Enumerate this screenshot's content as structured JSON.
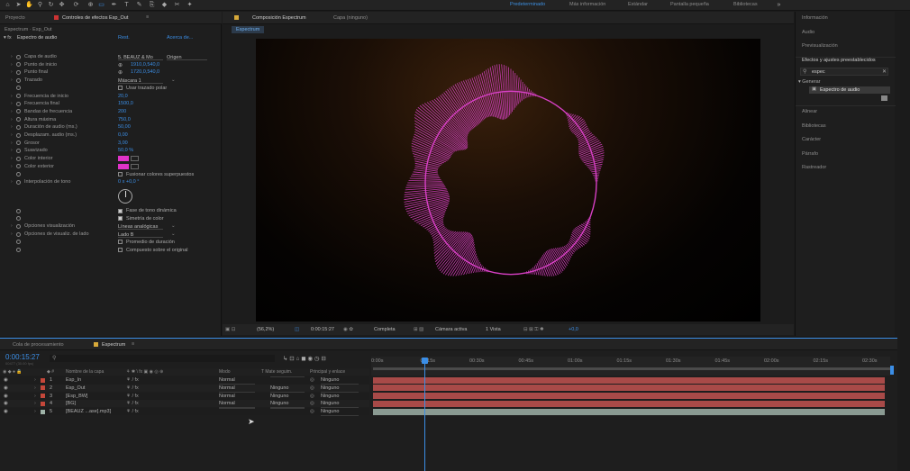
{
  "workspaces": [
    "Predeterminado",
    "Más información",
    "Estándar",
    "Pantalla pequeña",
    "Bibliotecas"
  ],
  "left_tabs": {
    "project": "Proyecto",
    "effects": "Controles de efectos Esp_Out",
    "subtitle": "Espectrum · Esp_Out"
  },
  "effect": {
    "name": "Espectro de audio",
    "reset": "Rest.",
    "about": "Acerca de...",
    "props": [
      {
        "label": "Capa de audio",
        "value": "5. BEAUZ & Mo",
        "value2": "Origen",
        "kind": "dd"
      },
      {
        "label": "Punto de inicio",
        "value": "1910,0,540,0",
        "kind": "point"
      },
      {
        "label": "Punto final",
        "value": "1720,0,540,0",
        "kind": "point"
      },
      {
        "label": "Trazado",
        "value": "Máscara 1",
        "kind": "dd"
      },
      {
        "label": "",
        "value": "Usar trazado polar",
        "kind": "check"
      },
      {
        "label": "Frecuencia de inicio",
        "value": "20,0",
        "kind": "num"
      },
      {
        "label": "Frecuencia final",
        "value": "1500,0",
        "kind": "num"
      },
      {
        "label": "Bandas de frecuencia",
        "value": "200",
        "kind": "num"
      },
      {
        "label": "Altura máxima",
        "value": "750,0",
        "kind": "num"
      },
      {
        "label": "Duración de audio (ms.)",
        "value": "50,00",
        "kind": "num"
      },
      {
        "label": "Desplazam. audio (ms.)",
        "value": "0,00",
        "kind": "num"
      },
      {
        "label": "Grosor",
        "value": "3,00",
        "kind": "num"
      },
      {
        "label": "Suavizado",
        "value": "50,0 %",
        "kind": "num"
      },
      {
        "label": "Color interior",
        "value": "",
        "kind": "color"
      },
      {
        "label": "Color exterior",
        "value": "",
        "kind": "color"
      },
      {
        "label": "",
        "value": "Fusionar colores superpuestos",
        "kind": "check"
      },
      {
        "label": "Interpolación de tono",
        "value": "0 x +0,0 °",
        "kind": "num"
      }
    ],
    "props2": [
      {
        "label": "",
        "value": "Fase de tono dinámica",
        "kind": "check",
        "on": true
      },
      {
        "label": "",
        "value": "Simetría de color",
        "kind": "check",
        "on": true
      },
      {
        "label": "Opciones visualización",
        "value": "Líneas analógicas",
        "kind": "dd"
      },
      {
        "label": "Opciones de visualiz. de lado",
        "value": "Lado B",
        "kind": "dd"
      },
      {
        "label": "",
        "value": "Promedio de duración",
        "kind": "check",
        "on": false
      },
      {
        "label": "",
        "value": "Compuesto sobre el original",
        "kind": "check",
        "on": false
      }
    ]
  },
  "comp": {
    "tab": "Composición Espectrum",
    "layer_tab": "Capa (ninguno)",
    "sub_tab": "Espectrum",
    "zoom": "(56,2%)",
    "time": "0:00:15:27",
    "quality": "Completa",
    "camera": "Cámara activa",
    "views": "1 Vista",
    "exposure": "+0,0"
  },
  "right_panel": {
    "items_top": [
      "Información",
      "Audio",
      "Previsualización"
    ],
    "effects_title": "Efectos y ajustes preestablecidos",
    "search": "espec",
    "group": "Generar",
    "result": "Espectro de audio",
    "items_bottom": [
      "Alinear",
      "Bibliotecas",
      "Carácter",
      "Párrafo",
      "Rastreador"
    ]
  },
  "timeline": {
    "queue_tab": "Cola de procesamiento",
    "comp_tab": "Espectrum",
    "timecode": "0:00:15:27",
    "timecode_sub": "00477 (30.00 fps)",
    "headers": {
      "name": "Nombre de la capa",
      "mode": "Modo",
      "trkmat": "T  Mate seguim.",
      "parent": "Principal y enlace"
    },
    "ticks": [
      "0:00s",
      "00:15s",
      "00:30s",
      "00:45s",
      "01:00s",
      "01:15s",
      "01:30s",
      "01:45s",
      "02:00s",
      "02:15s",
      "02:30s"
    ],
    "layers": [
      {
        "num": "1",
        "name": "Esp_In",
        "mode": "Normal",
        "trk": "",
        "parent": "Ninguno",
        "color": "#c4473a"
      },
      {
        "num": "2",
        "name": "Esp_Out",
        "mode": "Normal",
        "trk": "Ninguno",
        "parent": "Ninguno",
        "color": "#c4473a"
      },
      {
        "num": "3",
        "name": "[Esp_BW]",
        "mode": "Normal",
        "trk": "Ninguno",
        "parent": "Ninguno",
        "color": "#c4473a"
      },
      {
        "num": "4",
        "name": "[BG]",
        "mode": "Normal",
        "trk": "Ninguno",
        "parent": "Ninguno",
        "color": "#c4473a"
      },
      {
        "num": "5",
        "name": "[BEAUZ ...ase].mp3]",
        "mode": "",
        "trk": "",
        "parent": "Ninguno",
        "color": "#9fb3a8"
      }
    ]
  },
  "colors": {
    "accent": "#3b8ee6",
    "spectrum": "#d640c4",
    "track": "#a84a48"
  }
}
